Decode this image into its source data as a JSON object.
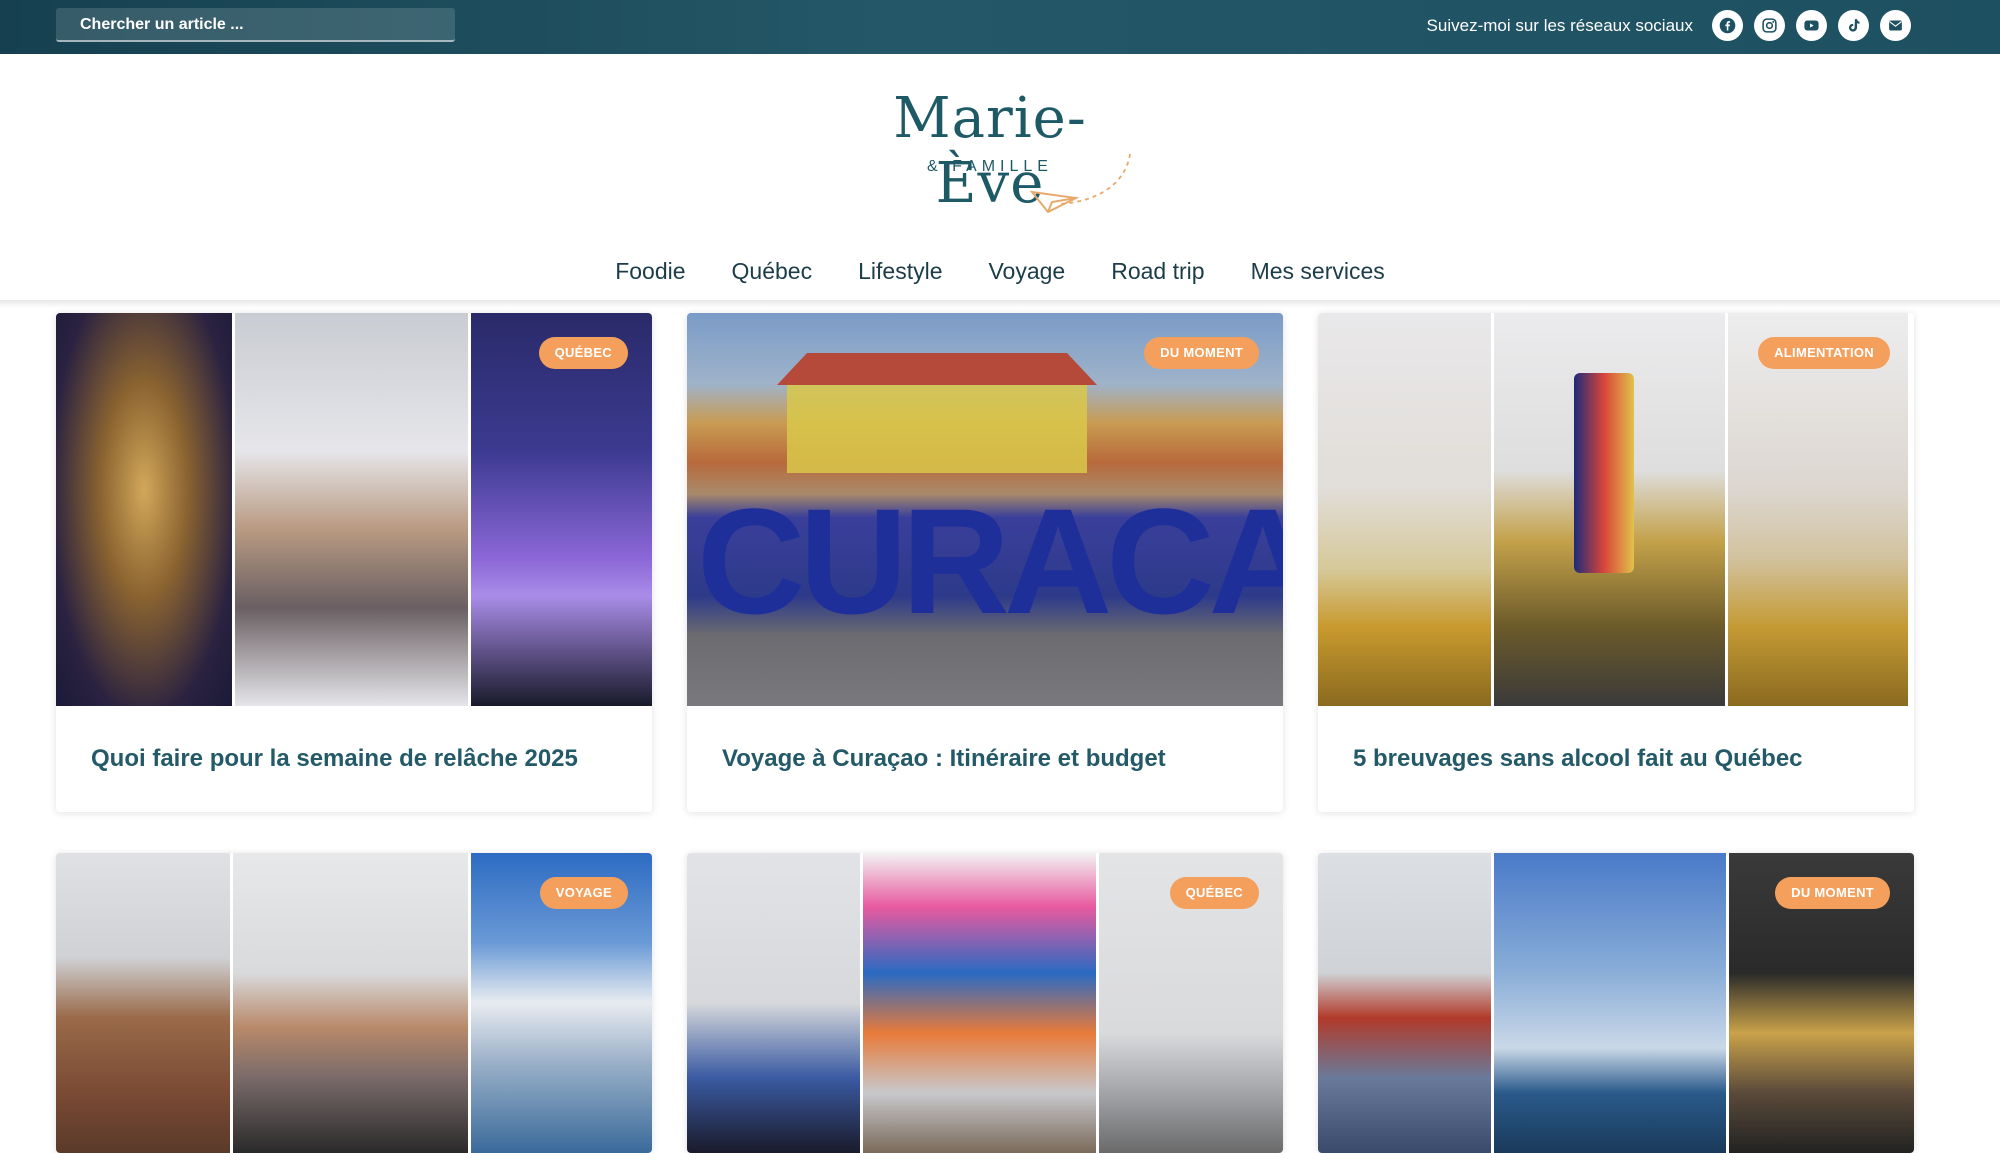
{
  "topbar": {
    "search_placeholder": "Chercher un article ...",
    "social_label": "Suivez-moi sur les réseaux sociaux",
    "social_icons": [
      "facebook-icon",
      "instagram-icon",
      "youtube-icon",
      "tiktok-icon",
      "email-icon"
    ]
  },
  "logo": {
    "name": "Marie-Ève",
    "sub": "& FAMILLE"
  },
  "nav": [
    "Foodie",
    "Québec",
    "Lifestyle",
    "Voyage",
    "Road trip",
    "Mes services"
  ],
  "cards": [
    {
      "badge": "QUÉBEC",
      "title": "Quoi faire pour la semaine de relâche 2025"
    },
    {
      "badge": "DU MOMENT",
      "title": "Voyage à Curaçao : Itinéraire et budget"
    },
    {
      "badge": "ALIMENTATION",
      "title": "5 breuvages sans alcool fait au Québec"
    },
    {
      "badge": "VOYAGE",
      "title": ""
    },
    {
      "badge": "QUÉBEC",
      "title": ""
    },
    {
      "badge": "DU MOMENT",
      "title": ""
    }
  ],
  "colors": {
    "topbar": "#1d5060",
    "accent_badge": "#f4a05c",
    "title": "#245a68"
  }
}
